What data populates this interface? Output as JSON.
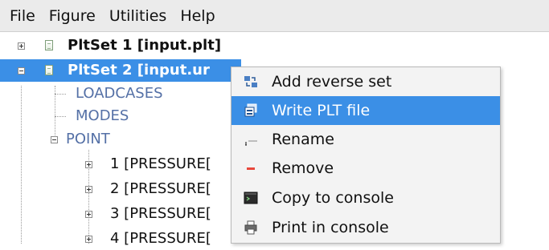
{
  "menubar": {
    "items": [
      "File",
      "Figure",
      "Utilities",
      "Help"
    ]
  },
  "tree": {
    "plotsets": [
      {
        "label": "PltSet 1 [input.plt]",
        "expanded": false
      },
      {
        "label": "PltSet 2 [input.ur",
        "expanded": true,
        "selected": true
      }
    ],
    "children": [
      "LOADCASES",
      "MODES",
      "POINT"
    ],
    "points": [
      "1 [PRESSURE[",
      "2 [PRESSURE[",
      "3 [PRESSURE[",
      "4 [PRESSURE["
    ]
  },
  "context_menu": {
    "items": [
      {
        "label": "Add reverse set",
        "icon": "reverse-set-icon"
      },
      {
        "label": "Write PLT file",
        "icon": "write-file-icon",
        "highlighted": true
      },
      {
        "label": "Rename",
        "icon": "rename-icon"
      },
      {
        "label": "Remove",
        "icon": "remove-icon"
      },
      {
        "label": "Copy to console",
        "icon": "console-icon"
      },
      {
        "label": "Print in console",
        "icon": "printer-icon"
      }
    ]
  },
  "colors": {
    "selection": "#3b8fe6",
    "tree_secondary_text": "#5470a6",
    "remove_icon": "#e8473b"
  }
}
